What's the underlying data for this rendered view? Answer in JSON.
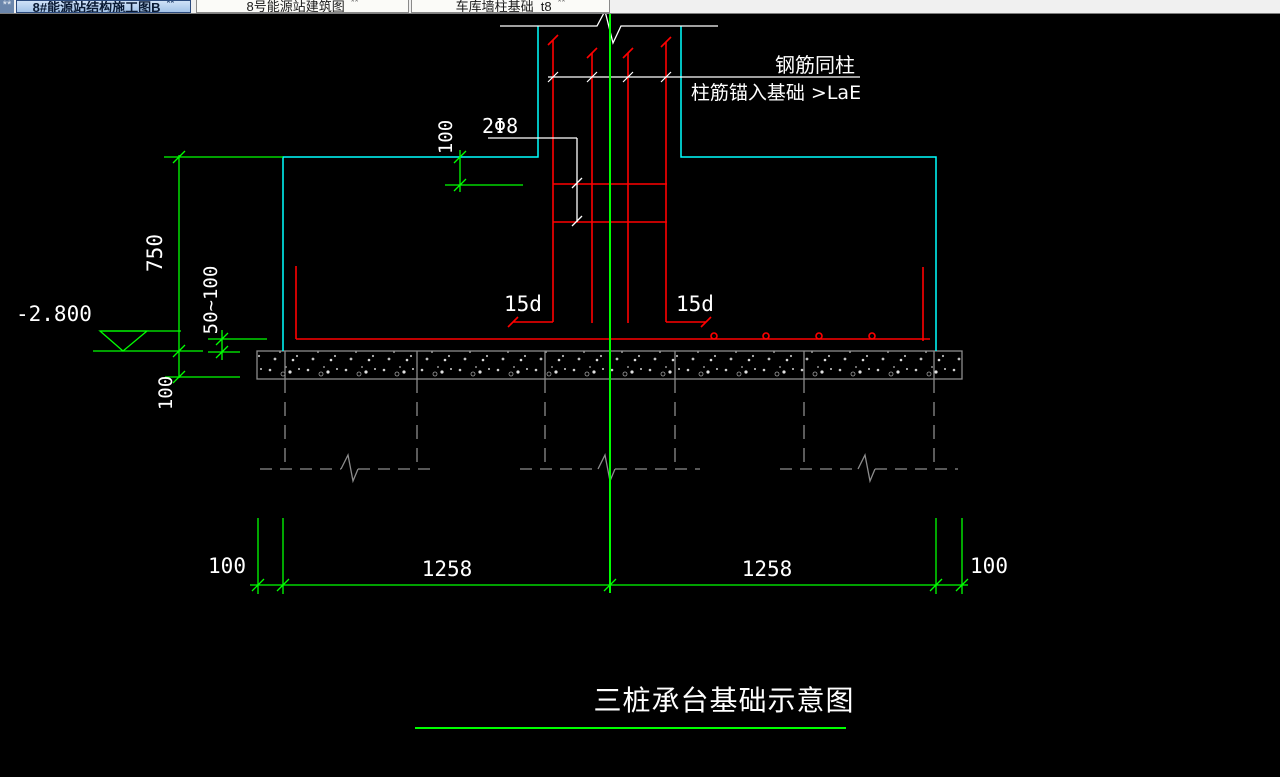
{
  "tabs": [
    {
      "label": "8#能源站结构施工图B",
      "badge": "**",
      "active": true
    },
    {
      "label": "8号能源站建筑图",
      "badge": "**",
      "active": false
    },
    {
      "label": "车库墙柱基础_t8",
      "badge": "**",
      "active": false
    }
  ],
  "drawing": {
    "title": "三桩承台基础示意图",
    "annotations": {
      "note_line1": "钢筋同柱",
      "note_line2": "柱筋锚入基础 >LaE",
      "added_bar": "2Φ8",
      "hook_left": "15d",
      "hook_right": "15d",
      "level": "-2.800"
    },
    "dimensions": {
      "cap_height": "750",
      "pile_embed": "50~100",
      "bedding_thickness": "100",
      "top_offset": "100",
      "left_overhang": "100",
      "left_span": "1258",
      "right_span": "1258",
      "right_overhang": "100"
    },
    "colors": {
      "outline": "#00ffff",
      "rebar": "#ff0000",
      "dimension": "#00ff00",
      "text": "#ffffff",
      "ground": "#8c8c8c"
    }
  }
}
